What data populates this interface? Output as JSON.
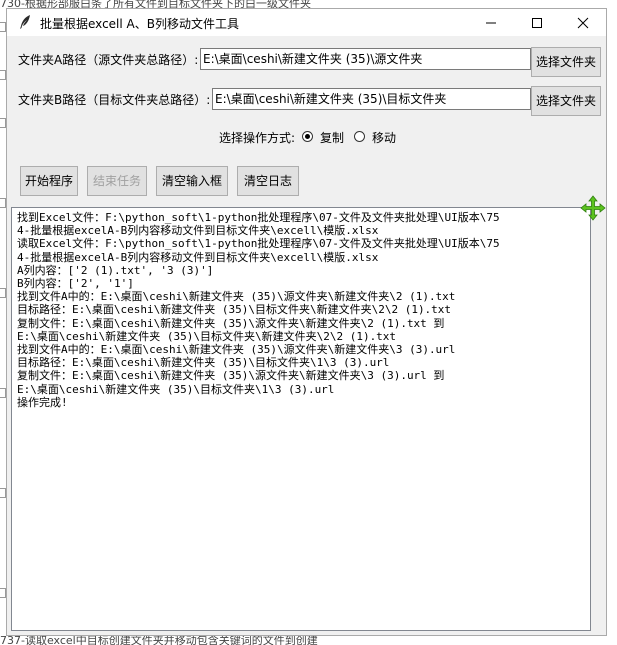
{
  "background": {
    "top_text": "730-根据形部服白条了所有文件到目标文件夹下的白一级文件夹",
    "bottom_text": "737-读取excel中目标创建文件夹并移动包含关键词的文件到创建"
  },
  "window": {
    "title": "批量根据excell A、B列移动文件工具",
    "title_icon": "feather-icon",
    "controls": {
      "minimize": "minimize-icon",
      "maximize": "maximize-icon",
      "close": "close-icon"
    }
  },
  "form": {
    "folder_a_label": "文件夹A路径（源文件夹总路径）:",
    "folder_a_value": "E:\\桌面\\ceshi\\新建文件夹 (35)\\源文件夹",
    "folder_a_button": "选择文件夹",
    "folder_b_label": "文件夹B路径（目标文件夹总路径）:",
    "folder_b_value": "E:\\桌面\\ceshi\\新建文件夹 (35)\\目标文件夹",
    "folder_b_button": "选择文件夹",
    "operation_label": "选择操作方式:",
    "operation_options": [
      "复制",
      "移动"
    ],
    "operation_selected": "复制"
  },
  "toolbar": {
    "start_label": "开始程序",
    "stop_label": "结束任务",
    "clear_input_label": "清空输入框",
    "clear_log_label": "清空日志"
  },
  "log": {
    "lines": [
      "找到Excel文件：F:\\python_soft\\1-python批处理程序\\07-文件及文件夹批处理\\UI版本\\75",
      "4-批量根据excelA-B列内容移动文件到目标文件夹\\excell\\模版.xlsx",
      "读取Excel文件：F:\\python_soft\\1-python批处理程序\\07-文件及文件夹批处理\\UI版本\\75",
      "4-批量根据excelA-B列内容移动文件到目标文件夹\\excell\\模版.xlsx",
      "A列内容：['2 (1).txt', '3 (3)']",
      "B列内容：['2', '1']",
      "找到文件A中的：E:\\桌面\\ceshi\\新建文件夹 (35)\\源文件夹\\新建文件夹\\2 (1).txt",
      "目标路径：E:\\桌面\\ceshi\\新建文件夹 (35)\\目标文件夹\\新建文件夹\\2\\2 (1).txt",
      "复制文件：E:\\桌面\\ceshi\\新建文件夹 (35)\\源文件夹\\新建文件夹\\2 (1).txt 到",
      "E:\\桌面\\ceshi\\新建文件夹 (35)\\目标文件夹\\新建文件夹\\2\\2 (1).txt",
      "找到文件A中的：E:\\桌面\\ceshi\\新建文件夹 (35)\\源文件夹\\新建文件夹\\3 (3).url",
      "目标路径：E:\\桌面\\ceshi\\新建文件夹 (35)\\目标文件夹\\1\\3 (3).url",
      "复制文件：E:\\桌面\\ceshi\\新建文件夹 (35)\\源文件夹\\新建文件夹\\3 (3).url 到",
      "E:\\桌面\\ceshi\\新建文件夹 (35)\\目标文件夹\\1\\3 (3).url",
      "操作完成!"
    ]
  },
  "cursor": "move-cursor-icon"
}
